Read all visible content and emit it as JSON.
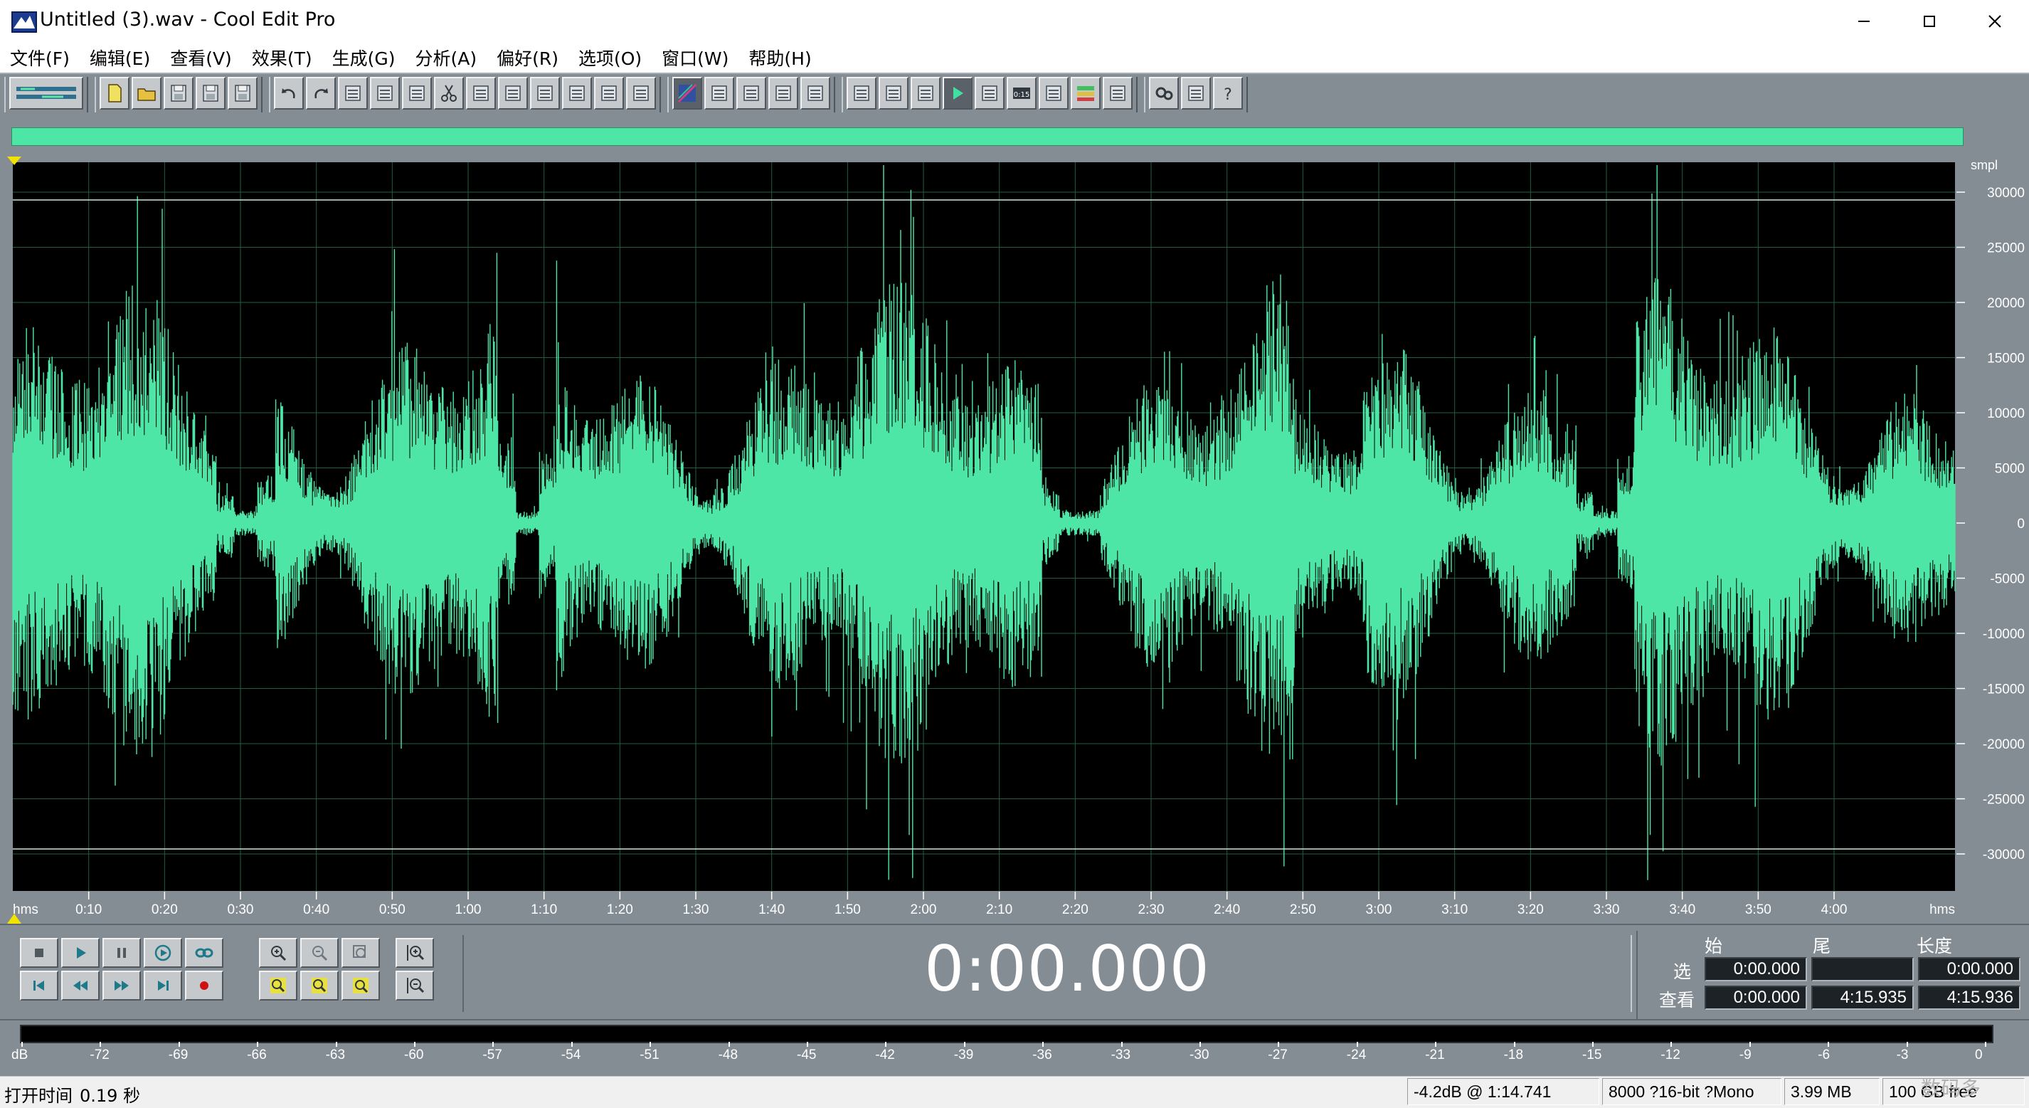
{
  "window": {
    "title": "Untitled (3).wav - Cool Edit Pro"
  },
  "menu": [
    "文件(F)",
    "编辑(E)",
    "查看(V)",
    "效果(T)",
    "生成(G)",
    "分析(A)",
    "偏好(R)",
    "选项(O)",
    "窗口(W)",
    "帮助(H)"
  ],
  "toolbar": {
    "groups": [
      [
        "multitrack-toggle"
      ],
      [
        "new-file",
        "open-file",
        "save-file",
        "save-as",
        "close-file"
      ],
      [
        "undo",
        "redo",
        "repeat-last",
        "mix-paste",
        "copy",
        "cut",
        "paste",
        "paste-new",
        "insert-cue",
        "mark",
        "amplify",
        "trim"
      ],
      [
        "spectral-view",
        "show-cues",
        "cd-mode-1",
        "cd-mode-2",
        "cd-mode-3"
      ],
      [
        "view-transport",
        "view-time",
        "view-zoom",
        "view-play",
        "view-zoom2",
        "view-timecode",
        "view-grid",
        "view-levels",
        "view-status"
      ],
      [
        "settings",
        "scripts",
        "help"
      ]
    ]
  },
  "waveform": {
    "color": "#4ee6a6",
    "background": "#000000",
    "grid_color": "#1f5f3f",
    "sample_scale": {
      "unit": "smpl",
      "ticks": [
        "30000",
        "25000",
        "20000",
        "15000",
        "10000",
        "5000",
        "0",
        "-5000",
        "-10000",
        "-15000",
        "-20000",
        "-25000",
        "-30000"
      ]
    },
    "time_ruler": {
      "unit_left": "hms",
      "unit_right": "hms",
      "ticks": [
        "0:10",
        "0:20",
        "0:30",
        "0:40",
        "0:50",
        "1:00",
        "1:10",
        "1:20",
        "1:30",
        "1:40",
        "1:50",
        "2:00",
        "2:10",
        "2:20",
        "2:30",
        "2:40",
        "2:50",
        "3:00",
        "3:10",
        "3:20",
        "3:30",
        "3:40",
        "3:50",
        "4:00"
      ]
    }
  },
  "transport": {
    "time": "0:00.000",
    "buttons": [
      "stop",
      "play",
      "pause",
      "play-to-end",
      "loop",
      "go-to-start",
      "rewind",
      "fast-forward",
      "go-to-end",
      "record"
    ],
    "zoom_buttons": [
      "zoom-in-h",
      "zoom-out-h",
      "zoom-full",
      "zoom-in-left",
      "zoom-in-right",
      "zoom-selection",
      "zoom-in-v",
      "zoom-out-v"
    ]
  },
  "selection": {
    "headers": {
      "begin": "始",
      "end": "尾",
      "length": "长度"
    },
    "select_label": "选",
    "view_label": "查看",
    "select": {
      "begin": "0:00.000",
      "end": "",
      "length": "0:00.000"
    },
    "view": {
      "begin": "0:00.000",
      "end": "4:15.935",
      "length": "4:15.936"
    }
  },
  "level_meter": {
    "ticks": [
      "dB",
      "-72",
      "-69",
      "-66",
      "-63",
      "-60",
      "-57",
      "-54",
      "-51",
      "-48",
      "-45",
      "-42",
      "-39",
      "-36",
      "-33",
      "-30",
      "-27",
      "-24",
      "-21",
      "-18",
      "-15",
      "-12",
      "-9",
      "-6",
      "-3",
      "0"
    ]
  },
  "status": {
    "open_time_label": "打开时间",
    "open_time": "0.19 秒",
    "cursor": "-4.2dB @   1:14.741",
    "format": "8000 ?16-bit ?Mono",
    "size": "3.99 MB",
    "free": "100 GB free",
    "watermark": "数码多"
  }
}
